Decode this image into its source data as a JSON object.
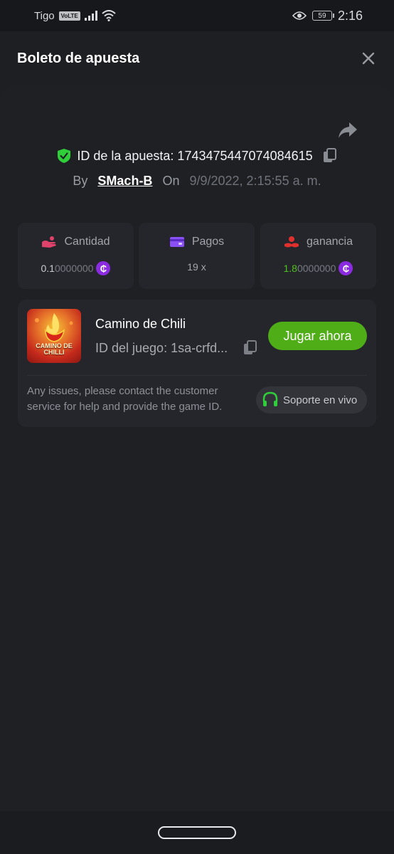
{
  "status_bar": {
    "carrier": "Tigo",
    "network_badge": "VoLTE",
    "battery": "59",
    "time": "2:16"
  },
  "header": {
    "title": "Boleto de apuesta",
    "close_icon": "close-icon"
  },
  "bet": {
    "id_label": "ID de la apuesta: 1743475447074084615",
    "by_label": "By",
    "username": "SMach-B",
    "on_label": "On",
    "date": "9/9/2022, 2:15:55 a. m."
  },
  "stats": [
    {
      "label": "Cantidad",
      "value_main": "0.1",
      "value_rest": "0000000",
      "icon": "bet-amount-icon",
      "color": "#e0426b"
    },
    {
      "label": "Pagos",
      "value": "19 x",
      "icon": "card-icon",
      "color": "#8a4ff5"
    },
    {
      "label": "ganancia",
      "value_main": "1.8",
      "value_rest": "0000000",
      "icon": "hand-coin-icon",
      "color": "#e0302d"
    }
  ],
  "coin_symbol": "₵",
  "game": {
    "name": "Camino de Chili",
    "id_label": "ID del juego: 1sa-crfd...",
    "thumb_text": "CAMINO DE CHILLI",
    "play_label": "Jugar ahora",
    "help_text": "Any issues, please contact the customer service for help and provide the game ID.",
    "support_label": "Soporte en vivo"
  },
  "colors": {
    "accent_green": "#4fae18",
    "shield_green": "#2fcf3a",
    "coin_purple": "#8b2be0"
  }
}
